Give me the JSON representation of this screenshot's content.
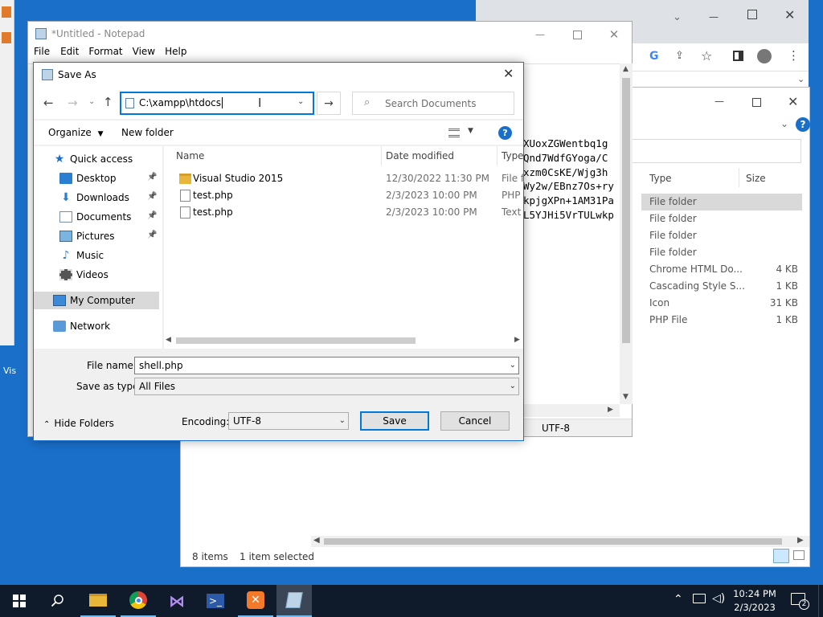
{
  "desktop": {
    "left_fragment_label": "Vis"
  },
  "back_explorer": {
    "columns": {
      "type": "Type",
      "size": "Size"
    },
    "rows": [
      {
        "type": "File folder",
        "size": ""
      },
      {
        "type": "File folder",
        "size": ""
      },
      {
        "type": "File folder",
        "size": ""
      },
      {
        "type": "File folder",
        "size": ""
      },
      {
        "type": "Chrome HTML Do...",
        "size": "4 KB"
      },
      {
        "type": "Cascading Style S...",
        "size": "1 KB"
      },
      {
        "type": "Icon",
        "size": "31 KB"
      },
      {
        "type": "PHP File",
        "size": "1 KB"
      }
    ],
    "status_items": "8 items",
    "status_selected": "1 item selected"
  },
  "notepad": {
    "title": "*Untitled - Notepad",
    "menu": [
      "File",
      "Edit",
      "Format",
      "View",
      "Help"
    ],
    "text_lines": [
      "XUoxZGWentbq1g",
      "Qnd7WdfGYoga/C",
      "xzm0CsKE/Wjg3h",
      "Wy2w/EBnz7Os+ry",
      "kpjgXPn+1AM31Pa",
      "L5YJHi5VrTULwkp"
    ],
    "status_encoding": "UTF-8"
  },
  "dialog": {
    "title": "Save As",
    "address_value": "C:\\xampp\\htdocs",
    "search_placeholder": "Search Documents",
    "organize_label": "Organize",
    "new_folder_label": "New folder",
    "help_label": "?",
    "nav": [
      {
        "label": "Quick access",
        "icon": "star-icon"
      },
      {
        "label": "Desktop",
        "icon": "desktop-folder-icon",
        "pinned": true
      },
      {
        "label": "Downloads",
        "icon": "downloads-icon",
        "pinned": true
      },
      {
        "label": "Documents",
        "icon": "documents-icon",
        "pinned": true
      },
      {
        "label": "Pictures",
        "icon": "pictures-icon",
        "pinned": true
      },
      {
        "label": "Music",
        "icon": "music-icon"
      },
      {
        "label": "Videos",
        "icon": "videos-icon"
      },
      {
        "label": "My Computer",
        "icon": "computer-icon"
      },
      {
        "label": "Network",
        "icon": "network-icon"
      }
    ],
    "columns": {
      "name": "Name",
      "date": "Date modified",
      "type": "Type"
    },
    "files": [
      {
        "name": "Visual Studio 2015",
        "date": "12/30/2022 11:30 PM",
        "type": "File fo",
        "icon": "folder-icon"
      },
      {
        "name": "test.php",
        "date": "2/3/2023 10:00 PM",
        "type": "PHP",
        "icon": "file-icon"
      },
      {
        "name": "test.php",
        "date": "2/3/2023 10:00 PM",
        "type": "Text",
        "icon": "file-icon"
      }
    ],
    "file_name_label": "File name:",
    "file_name_value": "shell.php",
    "save_type_label": "Save as type:",
    "save_type_value": "All Files",
    "hide_folders_label": "Hide Folders",
    "encoding_label": "Encoding:",
    "encoding_value": "UTF-8",
    "save_label": "Save",
    "cancel_label": "Cancel"
  },
  "taskbar": {
    "time": "10:24 PM",
    "date": "2/3/2023",
    "notification_count": "2"
  },
  "colors": {
    "accent": "#0078d7",
    "selection": "#cce8ff",
    "taskbar": "#0f1a2a"
  }
}
